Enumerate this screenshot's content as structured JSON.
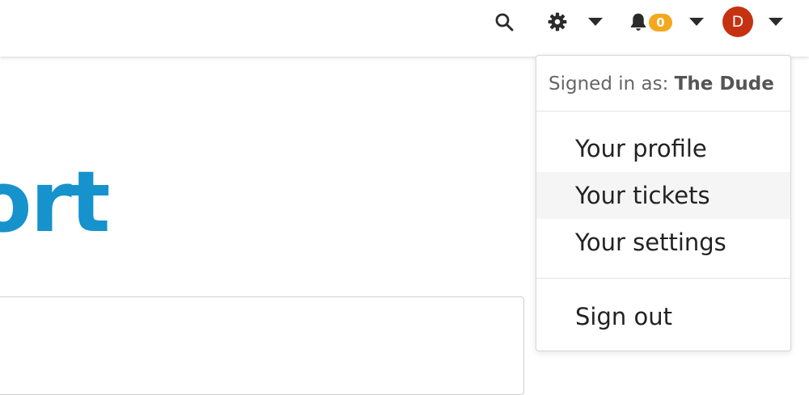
{
  "header": {
    "search_icon": "search-icon",
    "settings_icon": "gear-icon",
    "notifications": {
      "icon": "bell-icon",
      "count": "0",
      "badge_color": "#f4a81d"
    },
    "user": {
      "avatar_initial": "D",
      "avatar_color": "#c43212"
    }
  },
  "page": {
    "title_fragment": "ort",
    "title_color": "#1692cc"
  },
  "user_menu": {
    "signed_in_prefix": "Signed in as: ",
    "username": "The Dude",
    "items": [
      {
        "label": "Your profile"
      },
      {
        "label": "Your tickets"
      },
      {
        "label": "Your settings"
      }
    ],
    "sign_out_label": "Sign out"
  }
}
